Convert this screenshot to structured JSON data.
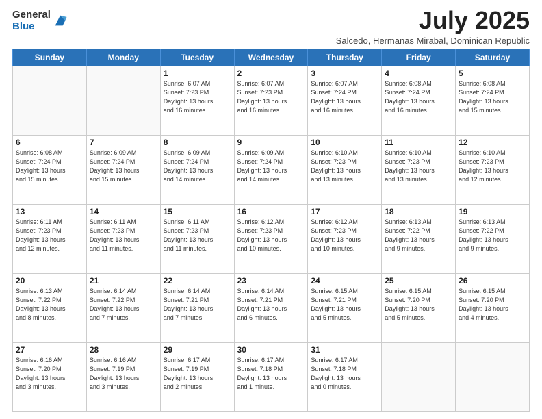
{
  "logo": {
    "general": "General",
    "blue": "Blue"
  },
  "header": {
    "month": "July 2025",
    "subtitle": "Salcedo, Hermanas Mirabal, Dominican Republic"
  },
  "weekdays": [
    "Sunday",
    "Monday",
    "Tuesday",
    "Wednesday",
    "Thursday",
    "Friday",
    "Saturday"
  ],
  "weeks": [
    [
      {
        "day": "",
        "info": ""
      },
      {
        "day": "",
        "info": ""
      },
      {
        "day": "1",
        "info": "Sunrise: 6:07 AM\nSunset: 7:23 PM\nDaylight: 13 hours\nand 16 minutes."
      },
      {
        "day": "2",
        "info": "Sunrise: 6:07 AM\nSunset: 7:23 PM\nDaylight: 13 hours\nand 16 minutes."
      },
      {
        "day": "3",
        "info": "Sunrise: 6:07 AM\nSunset: 7:24 PM\nDaylight: 13 hours\nand 16 minutes."
      },
      {
        "day": "4",
        "info": "Sunrise: 6:08 AM\nSunset: 7:24 PM\nDaylight: 13 hours\nand 16 minutes."
      },
      {
        "day": "5",
        "info": "Sunrise: 6:08 AM\nSunset: 7:24 PM\nDaylight: 13 hours\nand 15 minutes."
      }
    ],
    [
      {
        "day": "6",
        "info": "Sunrise: 6:08 AM\nSunset: 7:24 PM\nDaylight: 13 hours\nand 15 minutes."
      },
      {
        "day": "7",
        "info": "Sunrise: 6:09 AM\nSunset: 7:24 PM\nDaylight: 13 hours\nand 15 minutes."
      },
      {
        "day": "8",
        "info": "Sunrise: 6:09 AM\nSunset: 7:24 PM\nDaylight: 13 hours\nand 14 minutes."
      },
      {
        "day": "9",
        "info": "Sunrise: 6:09 AM\nSunset: 7:24 PM\nDaylight: 13 hours\nand 14 minutes."
      },
      {
        "day": "10",
        "info": "Sunrise: 6:10 AM\nSunset: 7:23 PM\nDaylight: 13 hours\nand 13 minutes."
      },
      {
        "day": "11",
        "info": "Sunrise: 6:10 AM\nSunset: 7:23 PM\nDaylight: 13 hours\nand 13 minutes."
      },
      {
        "day": "12",
        "info": "Sunrise: 6:10 AM\nSunset: 7:23 PM\nDaylight: 13 hours\nand 12 minutes."
      }
    ],
    [
      {
        "day": "13",
        "info": "Sunrise: 6:11 AM\nSunset: 7:23 PM\nDaylight: 13 hours\nand 12 minutes."
      },
      {
        "day": "14",
        "info": "Sunrise: 6:11 AM\nSunset: 7:23 PM\nDaylight: 13 hours\nand 11 minutes."
      },
      {
        "day": "15",
        "info": "Sunrise: 6:11 AM\nSunset: 7:23 PM\nDaylight: 13 hours\nand 11 minutes."
      },
      {
        "day": "16",
        "info": "Sunrise: 6:12 AM\nSunset: 7:23 PM\nDaylight: 13 hours\nand 10 minutes."
      },
      {
        "day": "17",
        "info": "Sunrise: 6:12 AM\nSunset: 7:23 PM\nDaylight: 13 hours\nand 10 minutes."
      },
      {
        "day": "18",
        "info": "Sunrise: 6:13 AM\nSunset: 7:22 PM\nDaylight: 13 hours\nand 9 minutes."
      },
      {
        "day": "19",
        "info": "Sunrise: 6:13 AM\nSunset: 7:22 PM\nDaylight: 13 hours\nand 9 minutes."
      }
    ],
    [
      {
        "day": "20",
        "info": "Sunrise: 6:13 AM\nSunset: 7:22 PM\nDaylight: 13 hours\nand 8 minutes."
      },
      {
        "day": "21",
        "info": "Sunrise: 6:14 AM\nSunset: 7:22 PM\nDaylight: 13 hours\nand 7 minutes."
      },
      {
        "day": "22",
        "info": "Sunrise: 6:14 AM\nSunset: 7:21 PM\nDaylight: 13 hours\nand 7 minutes."
      },
      {
        "day": "23",
        "info": "Sunrise: 6:14 AM\nSunset: 7:21 PM\nDaylight: 13 hours\nand 6 minutes."
      },
      {
        "day": "24",
        "info": "Sunrise: 6:15 AM\nSunset: 7:21 PM\nDaylight: 13 hours\nand 5 minutes."
      },
      {
        "day": "25",
        "info": "Sunrise: 6:15 AM\nSunset: 7:20 PM\nDaylight: 13 hours\nand 5 minutes."
      },
      {
        "day": "26",
        "info": "Sunrise: 6:15 AM\nSunset: 7:20 PM\nDaylight: 13 hours\nand 4 minutes."
      }
    ],
    [
      {
        "day": "27",
        "info": "Sunrise: 6:16 AM\nSunset: 7:20 PM\nDaylight: 13 hours\nand 3 minutes."
      },
      {
        "day": "28",
        "info": "Sunrise: 6:16 AM\nSunset: 7:19 PM\nDaylight: 13 hours\nand 3 minutes."
      },
      {
        "day": "29",
        "info": "Sunrise: 6:17 AM\nSunset: 7:19 PM\nDaylight: 13 hours\nand 2 minutes."
      },
      {
        "day": "30",
        "info": "Sunrise: 6:17 AM\nSunset: 7:18 PM\nDaylight: 13 hours\nand 1 minute."
      },
      {
        "day": "31",
        "info": "Sunrise: 6:17 AM\nSunset: 7:18 PM\nDaylight: 13 hours\nand 0 minutes."
      },
      {
        "day": "",
        "info": ""
      },
      {
        "day": "",
        "info": ""
      }
    ]
  ]
}
